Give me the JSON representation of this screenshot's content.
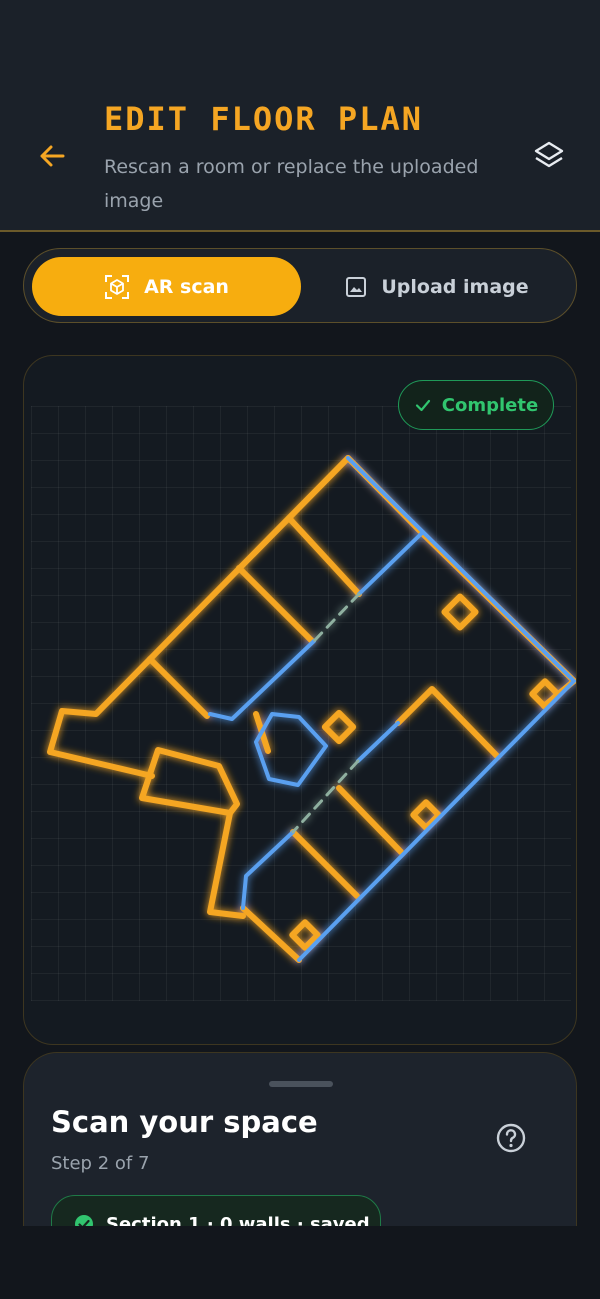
{
  "header": {
    "title": "EDIT FLOOR PLAN",
    "subtitle": "Rescan a room or replace the uploaded image"
  },
  "mode_toggle": {
    "ar_scan": "AR scan",
    "upload_image": "Upload image"
  },
  "canvas": {
    "status_badge": "Complete"
  },
  "sheet": {
    "title": "Scan your space",
    "step": "Step 2 of 7",
    "section_chip": "Section 1 · 0 walls · saved"
  },
  "colors": {
    "accent": "#f5a623",
    "scan_blue": "#5aa0f0",
    "success": "#31c56f",
    "background": "#12161c"
  },
  "icons": {
    "back": "arrow-left-icon",
    "layers": "layers-icon",
    "ar_scan": "ar-cube-icon",
    "upload": "image-icon",
    "complete": "check-icon",
    "help": "help-circle-icon",
    "saved": "check-circle-icon"
  }
}
